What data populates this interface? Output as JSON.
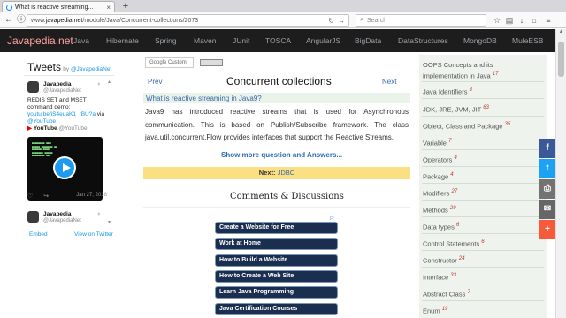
{
  "browser": {
    "tab_title": "What is reactive streaming...",
    "tab_close": "×",
    "new_tab": "+",
    "url_prefix": "www.",
    "url_domain": "javapedia.net",
    "url_path": "/module/Java/Concurrent-collections/2073",
    "search_placeholder": "Search",
    "icons": [
      "back-icon",
      "info-icon",
      "reload-icon",
      "search-icon",
      "star-icon",
      "download-icon",
      "home-icon",
      "menu-icon"
    ]
  },
  "header": {
    "logo": "Javapedia.net",
    "menu": [
      "Java",
      "Hibernate",
      "Spring",
      "Maven",
      "JUnit",
      "TOSCA",
      "AngularJS",
      "BigData",
      "DataStructures",
      "MongoDB",
      "MuleESB"
    ]
  },
  "twitter": {
    "title": "Tweets",
    "by": "by",
    "by_handle": "@JavapediaNet",
    "tweet1": {
      "name": "Javapedia",
      "handle": "@JavapediaNet",
      "text": "REDIS SET and MSET command demo:",
      "link": "youtu.be/iS4euaK1_rBU?a",
      "via": "via",
      "via_handle": "@YouTube",
      "yt_logo": "YouTube",
      "yt_handle": "@YouTube",
      "date": "Jan 27, 2018"
    },
    "tweet2": {
      "name": "Javapedia",
      "handle": "@JavapediaNet"
    },
    "embed": "Embed",
    "view_on": "View on Twitter"
  },
  "main": {
    "search_label": "Google Custom",
    "prev": "Prev",
    "next": "Next",
    "title": "Concurrent collections",
    "question": "What is reactive streaming in Java9?",
    "answer": "Java9 has introduced reactive streams that is used for Asynchronous communication. This is based on Publish/Subscribe framework. The class java.util.concurrent.Flow provides interfaces that support the Reactive Streams.",
    "show_more": "Show more question and Answers...",
    "next_label": "Next:",
    "next_value": "JDBC",
    "comments": "Comments & Discussions",
    "ad_mark": "▷",
    "ads": [
      "Create a Website for Free",
      "Work at Home",
      "How to Build a Website",
      "How to Create a Web Site",
      "Learn Java Programming",
      "Java Certification Courses"
    ]
  },
  "sidebar": {
    "items": [
      {
        "label": "OOPS Concepts and its implementation in Java",
        "count": "17"
      },
      {
        "label": "Java Identifiers",
        "count": "3"
      },
      {
        "label": "JDK, JRE, JVM, JIT",
        "count": "63"
      },
      {
        "label": "Object, Class and Package",
        "count": "35"
      },
      {
        "label": "Variable",
        "count": "7"
      },
      {
        "label": "Operators",
        "count": "4"
      },
      {
        "label": "Package",
        "count": "4"
      },
      {
        "label": "Modifiers",
        "count": "27"
      },
      {
        "label": "Methods",
        "count": "29"
      },
      {
        "label": "Data types",
        "count": "6"
      },
      {
        "label": "Control Statements",
        "count": "6"
      },
      {
        "label": "Constructor",
        "count": "24"
      },
      {
        "label": "Interface",
        "count": "33"
      },
      {
        "label": "Abstract Class",
        "count": "7"
      },
      {
        "label": "Enum",
        "count": "19"
      }
    ]
  },
  "share": {
    "facebook": "f",
    "twitter": "t",
    "print": "⎙",
    "email": "✉",
    "more": "+",
    "colors": {
      "facebook": "#3b5998",
      "twitter": "#1da1f2",
      "print": "#737373",
      "email": "#666666",
      "more": "#f65a3b"
    }
  },
  "colors": {
    "header_bg": "#1d1d1d",
    "logo": "#ffa3a0",
    "link": "#3867a8",
    "next_bar": "#fbe083",
    "question_bg": "#e9f3ea",
    "sidebar_bg": "#eef3ee"
  }
}
